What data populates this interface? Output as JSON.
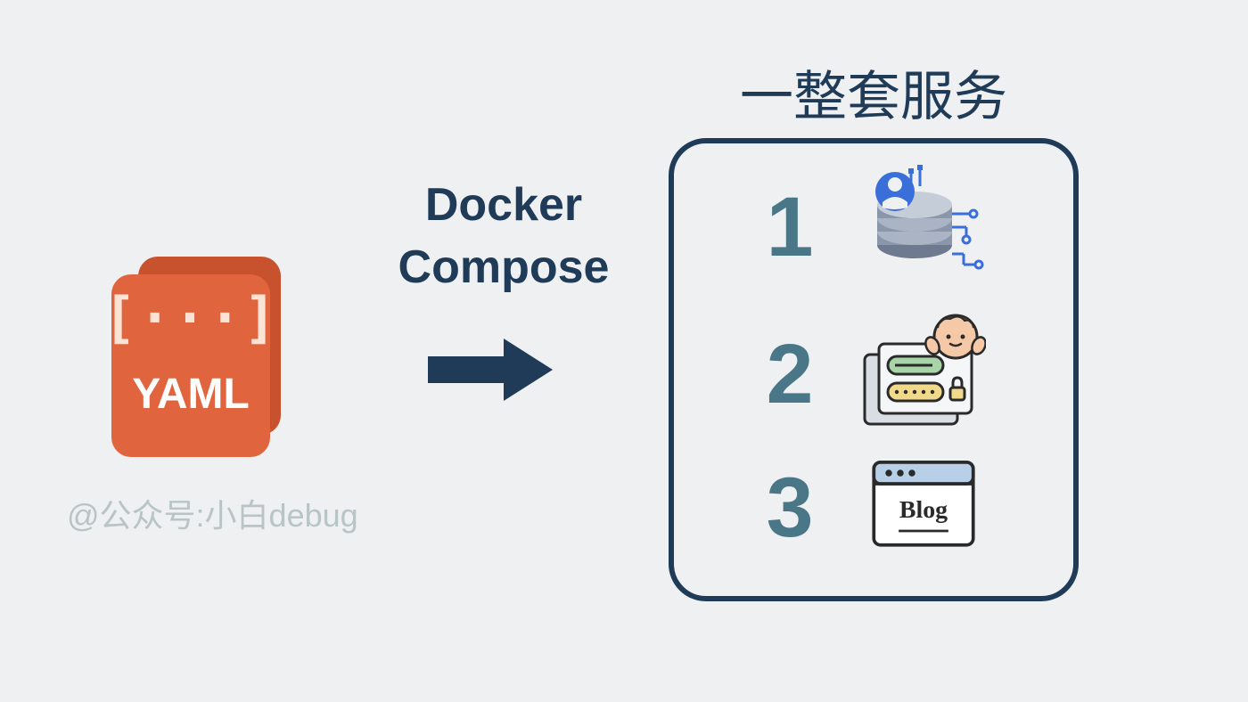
{
  "yaml": {
    "text": "YAML",
    "bracket_ellipsis": "[···]"
  },
  "compose": {
    "line1": "Docker",
    "line2": "Compose"
  },
  "attribution": "@公众号:小白debug",
  "services": {
    "title": "一整套服务",
    "items": [
      {
        "number": "1",
        "icon": "database-user"
      },
      {
        "number": "2",
        "icon": "login-credentials"
      },
      {
        "number": "3",
        "icon": "blog-window",
        "label": "Blog"
      }
    ]
  },
  "colors": {
    "bg": "#eef0f2",
    "navy": "#1f3b57",
    "teal": "#4a7787",
    "orange": "#e0643e",
    "orange_dark": "#c8512e",
    "icon_slate": "#6e7a8f",
    "icon_blue": "#3a6ed8"
  }
}
